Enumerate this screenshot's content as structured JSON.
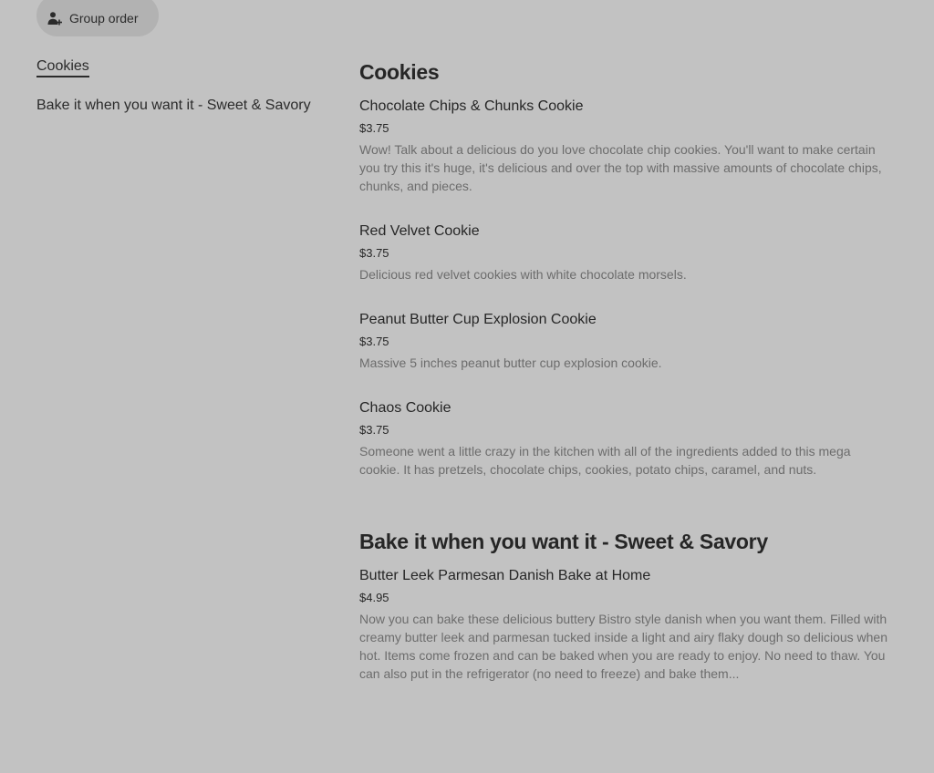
{
  "header": {
    "group_order_label": "Group order",
    "group_order_icon": "person-add-icon"
  },
  "sidebar": {
    "items": [
      {
        "label": "Cookies",
        "active": true
      },
      {
        "label": "Bake it when you want it - Sweet & Savory",
        "active": false
      }
    ]
  },
  "sections": [
    {
      "title": "Cookies",
      "items": [
        {
          "name": "Chocolate Chips & Chunks Cookie",
          "price": "$3.75",
          "description": "Wow! Talk about a delicious do you love chocolate chip cookies. You'll want to make certain you try this it's huge, it's delicious and over the top with massive amounts of chocolate chips, chunks, and pieces."
        },
        {
          "name": "Red Velvet Cookie",
          "price": "$3.75",
          "description": "Delicious red velvet cookies with white chocolate morsels."
        },
        {
          "name": "Peanut Butter Cup Explosion Cookie",
          "price": "$3.75",
          "description": "Massive 5 inches peanut butter cup explosion cookie."
        },
        {
          "name": "Chaos Cookie",
          "price": "$3.75",
          "description": "Someone went a little crazy in the kitchen with all of the ingredients added to this mega cookie. It has pretzels, chocolate chips, cookies, potato chips, caramel, and nuts."
        }
      ]
    },
    {
      "title": "Bake it when you want it - Sweet & Savory",
      "items": [
        {
          "name": "Butter Leek Parmesan Danish Bake at Home",
          "price": "$4.95",
          "description": "Now you can bake these delicious buttery Bistro style danish when you want them. Filled with creamy butter leek and parmesan tucked inside a light and airy flaky dough so delicious when hot. Items come frozen and can be baked when you are ready to enjoy. No need to thaw. You can also put in the refrigerator (no need to freeze) and bake them..."
        }
      ]
    }
  ]
}
